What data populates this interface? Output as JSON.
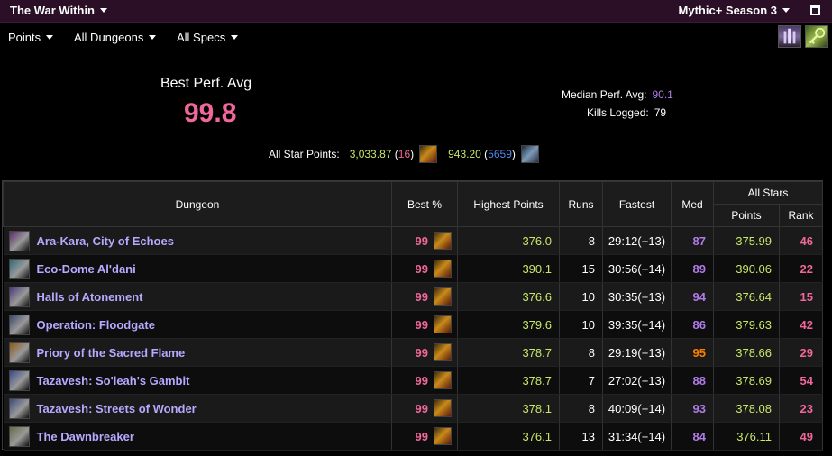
{
  "topbar": {
    "expansion": "The War Within",
    "season": "Mythic+ Season 3"
  },
  "filters": {
    "metric": "Points",
    "dungeons": "All Dungeons",
    "specs": "All Specs"
  },
  "summary": {
    "best_label": "Best Perf. Avg",
    "best_value": "99.8",
    "median_label": "Median Perf. Avg:",
    "median_value": "90.1",
    "kills_label": "Kills Logged:",
    "kills_value": "79",
    "allstar_label": "All Star Points:",
    "allstar_points_1": "3,033.87",
    "allstar_rank_1": "16",
    "allstar_points_2": "943.20",
    "allstar_rank_2": "5659"
  },
  "table": {
    "headers": {
      "dungeon": "Dungeon",
      "best": "Best %",
      "highest": "Highest Points",
      "runs": "Runs",
      "fastest": "Fastest",
      "med": "Med",
      "allstars": "All Stars",
      "points": "Points",
      "rank": "Rank"
    },
    "rows": [
      {
        "name": "Ara-Kara, City of Echoes",
        "best": "99",
        "highest": "376.0",
        "runs": "8",
        "fastest": "29:12(+13)",
        "med": "87",
        "med_color": "#b07be8",
        "points": "375.99",
        "rank": "46",
        "icon": "ara-kara-icon"
      },
      {
        "name": "Eco-Dome Al'dani",
        "best": "99",
        "highest": "390.1",
        "runs": "15",
        "fastest": "30:56(+14)",
        "med": "89",
        "med_color": "#b07be8",
        "points": "390.06",
        "rank": "22",
        "icon": "eco-dome-icon"
      },
      {
        "name": "Halls of Atonement",
        "best": "99",
        "highest": "376.6",
        "runs": "10",
        "fastest": "30:35(+13)",
        "med": "94",
        "med_color": "#b07be8",
        "points": "376.64",
        "rank": "15",
        "icon": "halls-icon"
      },
      {
        "name": "Operation: Floodgate",
        "best": "99",
        "highest": "379.6",
        "runs": "10",
        "fastest": "39:35(+14)",
        "med": "86",
        "med_color": "#b07be8",
        "points": "379.63",
        "rank": "42",
        "icon": "floodgate-icon"
      },
      {
        "name": "Priory of the Sacred Flame",
        "best": "99",
        "highest": "378.7",
        "runs": "8",
        "fastest": "29:19(+13)",
        "med": "95",
        "med_color": "#ff8000",
        "points": "378.66",
        "rank": "29",
        "icon": "priory-icon"
      },
      {
        "name": "Tazavesh: So'leah's Gambit",
        "best": "99",
        "highest": "378.7",
        "runs": "7",
        "fastest": "27:02(+13)",
        "med": "88",
        "med_color": "#b07be8",
        "points": "378.69",
        "rank": "54",
        "icon": "tazavesh-gambit-icon"
      },
      {
        "name": "Tazavesh: Streets of Wonder",
        "best": "99",
        "highest": "378.1",
        "runs": "8",
        "fastest": "40:09(+14)",
        "med": "93",
        "med_color": "#b07be8",
        "points": "378.08",
        "rank": "23",
        "icon": "tazavesh-streets-icon"
      },
      {
        "name": "The Dawnbreaker",
        "best": "99",
        "highest": "376.1",
        "runs": "13",
        "fastest": "31:34(+14)",
        "med": "84",
        "med_color": "#b07be8",
        "points": "376.11",
        "rank": "49",
        "icon": "dawnbreaker-icon"
      }
    ]
  }
}
